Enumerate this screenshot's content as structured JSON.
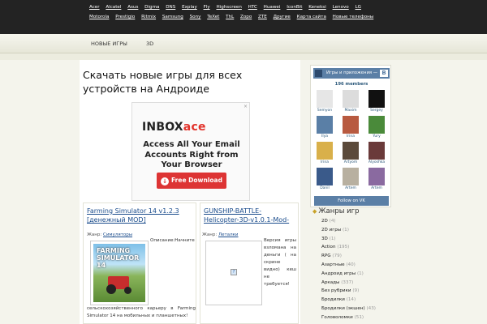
{
  "brands": [
    "Acer",
    "Alcatel",
    "Asus",
    "Digma",
    "DNS",
    "Explay",
    "Fly",
    "Highscreen",
    "HTC",
    "Huawei",
    "IconBit",
    "Keneksi",
    "Lenovo",
    "LG",
    "Motorola",
    "Prestigio",
    "Ritmix",
    "Samsung",
    "Sony",
    "TeXet",
    "ThL",
    "Zopo",
    "ZTE",
    "Другие",
    "Карта сайта",
    "Новые телефоны"
  ],
  "nav": {
    "new_games": "НОВЫЕ ИГРЫ",
    "3d": "3D"
  },
  "main": {
    "title": "Скачать новые игры для всех устройств на Андроиде"
  },
  "ad": {
    "logo_a": "INBOX",
    "logo_b": "ace",
    "text": "Access All Your Email Accounts Right from Your Browser",
    "button": "Free Download",
    "close": "×"
  },
  "cards": [
    {
      "title": "Farming Simulator 14 v1.2.3 [денежный MOD]",
      "genre_label": "Жанр:",
      "genre": "Симуляторы",
      "desc_side": "Описание:Начните",
      "desc_bottom": "сельскохозяйственного карьеру в Farming Simulator 14 на мобильных и планшетных!",
      "img_text": "FARMING SIMULATOR 14"
    },
    {
      "title": "GUNSHIP-BATTLE-Helicopter-3D-v1.0.1-Mod-",
      "genre_label": "Жанр:",
      "genre": "Леталки",
      "desc_side": "Версия игры взломана на деньги ( на скрине видно) кеш не требуется!",
      "broken": "?"
    }
  ],
  "vk": {
    "header": "Игры и приложения —",
    "logo": "В",
    "members_count": "196 members",
    "members": [
      {
        "name": "Semyon",
        "color": "#e6e6e6"
      },
      {
        "name": "Maxim",
        "color": "#dcdcdc"
      },
      {
        "name": "Sergey",
        "color": "#111111"
      },
      {
        "name": "Ilya",
        "color": "#5a7fa6"
      },
      {
        "name": "Irina",
        "color": "#b85a40"
      },
      {
        "name": "Yury",
        "color": "#4a8a3a"
      },
      {
        "name": "Irina",
        "color": "#d9b04a"
      },
      {
        "name": "Artyom",
        "color": "#5b4a3a"
      },
      {
        "name": "Alyoshka",
        "color": "#6a3a3a"
      },
      {
        "name": "Danil",
        "color": "#3a5a8a"
      },
      {
        "name": "Artem",
        "color": "#b8b0a0"
      },
      {
        "name": "Artem",
        "color": "#8a6aa0"
      }
    ],
    "follow": "Follow on VK"
  },
  "genres": {
    "title": "Жанры игр",
    "items": [
      {
        "label": "2D",
        "count": "(4)"
      },
      {
        "label": "2D игры",
        "count": "(1)"
      },
      {
        "label": "3D",
        "count": "(1)"
      },
      {
        "label": "Action",
        "count": "(195)"
      },
      {
        "label": "RPG",
        "count": "(79)"
      },
      {
        "label": "Азартные",
        "count": "(40)"
      },
      {
        "label": "Андроид игры",
        "count": "(1)"
      },
      {
        "label": "Аркады",
        "count": "(337)"
      },
      {
        "label": "Без рубрики",
        "count": "(9)"
      },
      {
        "label": "Бродилки",
        "count": "(14)"
      },
      {
        "label": "Бродилки (экшен)",
        "count": "(43)"
      },
      {
        "label": "Головоломки",
        "count": "(51)"
      }
    ]
  }
}
